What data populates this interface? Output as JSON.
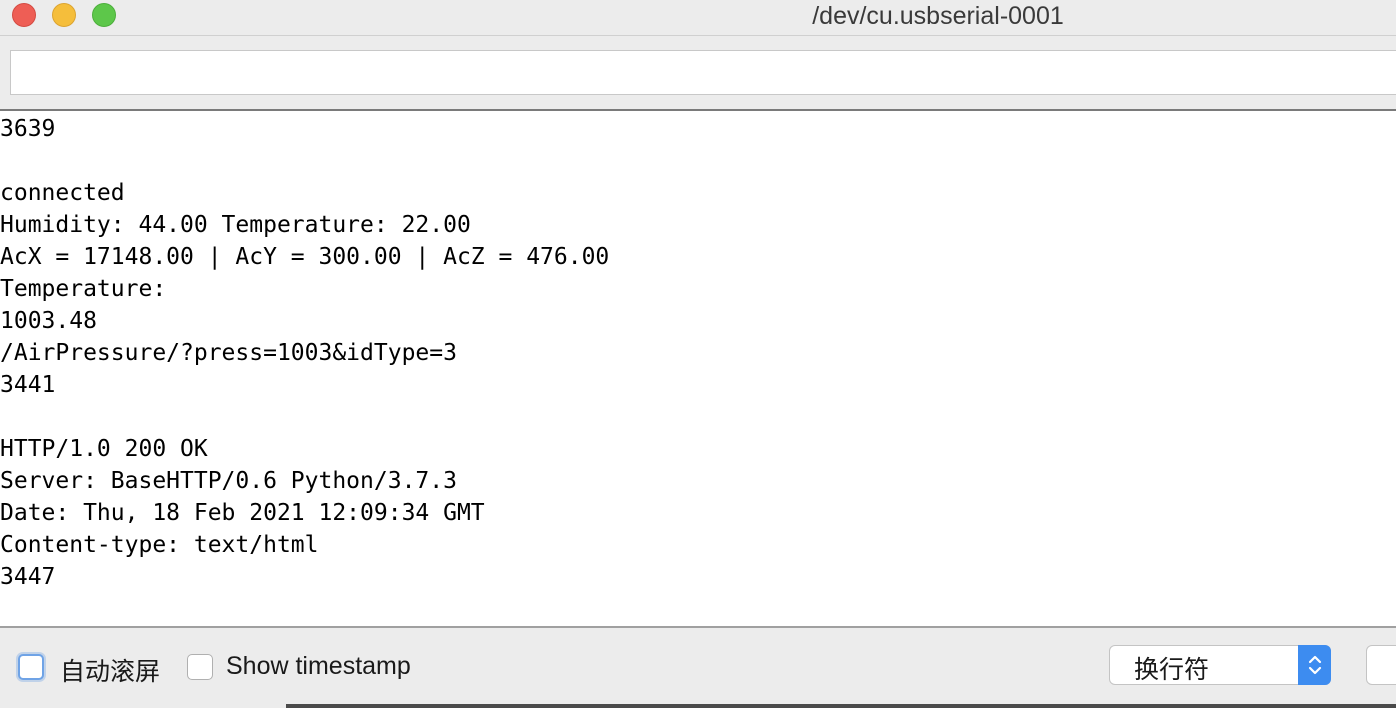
{
  "window": {
    "title": "/dev/cu.usbserial-0001"
  },
  "send_field": {
    "value": "",
    "placeholder": ""
  },
  "output": {
    "lines": [
      "3639",
      "",
      "connected",
      "Humidity: 44.00 Temperature: 22.00",
      "AcX = 17148.00 | AcY = 300.00 | AcZ = 476.00",
      "Temperature:",
      "1003.48",
      "/AirPressure/?press=1003&idType=3",
      "3441",
      "",
      "HTTP/1.0 200 OK",
      "Server: BaseHTTP/0.6 Python/3.7.3",
      "Date: Thu, 18 Feb 2021 12:09:34 GMT",
      "Content-type: text/html",
      "3447"
    ]
  },
  "bottom_bar": {
    "autoscroll_label": "自动滚屏",
    "autoscroll_checked": false,
    "timestamp_label": "Show timestamp",
    "timestamp_checked": false,
    "line_ending_value": "换行符"
  },
  "colors": {
    "close": "#ee5e55",
    "minimize": "#f5be3b",
    "zoom": "#5dc74a",
    "select_accent": "#3d8cf0",
    "focus_ring": "#6fa3e6"
  },
  "icons": {
    "close": "close-traffic-light",
    "minimize": "minimize-traffic-light",
    "zoom": "zoom-traffic-light",
    "select": "chevron-up-down-icon"
  }
}
